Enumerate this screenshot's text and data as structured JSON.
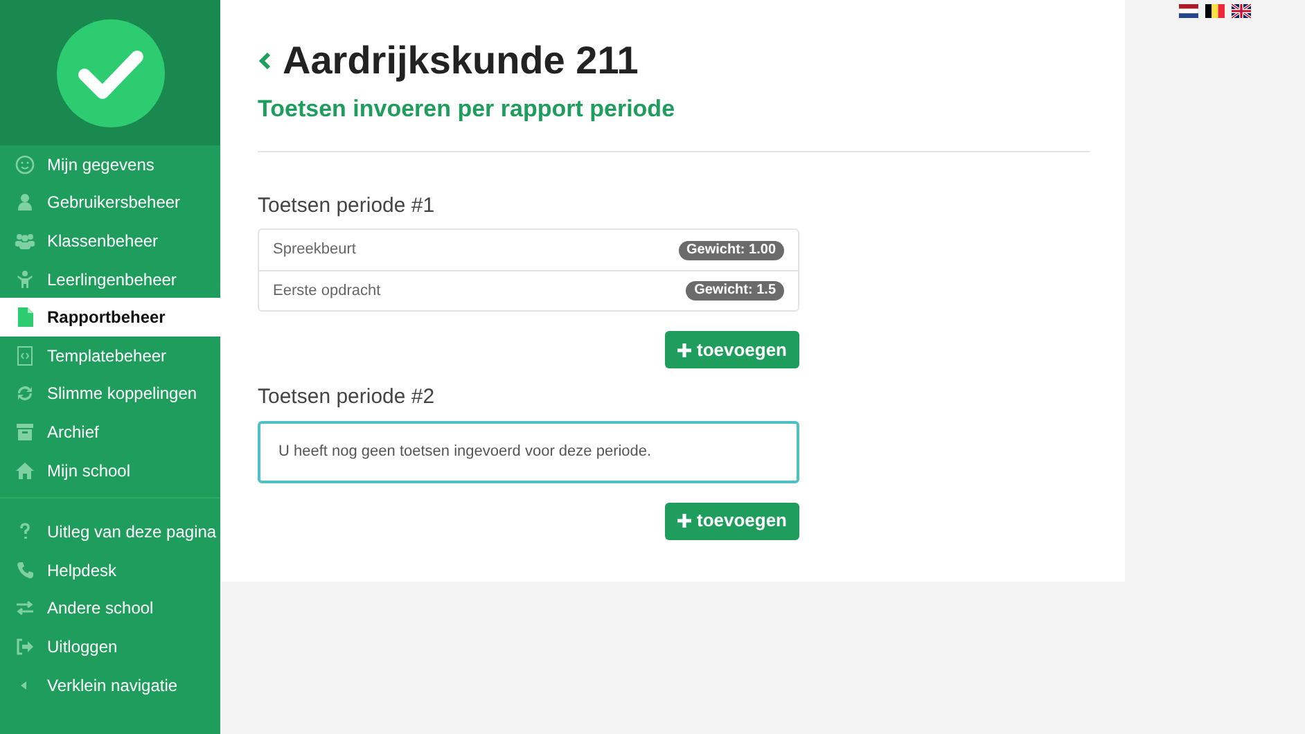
{
  "sidebar": {
    "groups": [
      {
        "items": [
          {
            "label": "Mijn gegevens",
            "selected": false
          },
          {
            "label": "Gebruikersbeheer",
            "selected": false
          },
          {
            "label": "Klassenbeheer",
            "selected": false
          },
          {
            "label": "Leerlingenbeheer",
            "selected": false
          },
          {
            "label": "Rapportbeheer",
            "selected": true
          },
          {
            "label": "Templatebeheer",
            "selected": false
          },
          {
            "label": "Slimme koppelingen",
            "selected": false
          },
          {
            "label": "Archief",
            "selected": false
          },
          {
            "label": "Mijn school",
            "selected": false
          }
        ]
      },
      {
        "items": [
          {
            "label": "Uitleg van deze pagina",
            "selected": false
          },
          {
            "label": "Helpdesk",
            "selected": false
          },
          {
            "label": "Andere school",
            "selected": false
          },
          {
            "label": "Uitloggen",
            "selected": false
          },
          {
            "label": "Verklein navigatie",
            "selected": false
          }
        ]
      }
    ]
  },
  "page": {
    "title": "Aardrijkskunde 211",
    "subtitle": "Toetsen invoeren per rapport periode"
  },
  "periods": [
    {
      "heading": "Toetsen periode #1",
      "tests": [
        {
          "name": "Spreekbeurt",
          "weight": "Gewicht: 1.00"
        },
        {
          "name": "Eerste opdracht",
          "weight": "Gewicht: 1.5"
        }
      ],
      "add_button": "toevoegen"
    },
    {
      "heading": "Toetsen periode #2",
      "empty_message": "U heeft nog geen toetsen ingevoerd voor deze periode.",
      "add_button": "toevoegen"
    }
  ]
}
